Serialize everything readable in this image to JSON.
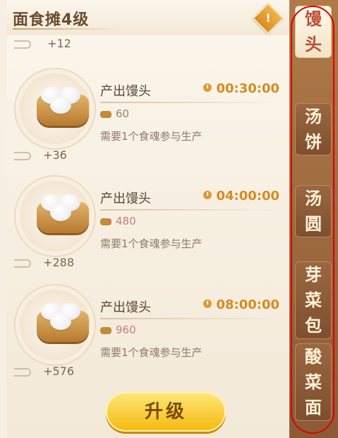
{
  "header": {
    "title": "面食摊4级",
    "info_icon": "!"
  },
  "top_bonus": "+12",
  "items": [
    {
      "title": "产出馒头",
      "time": "00:30:00",
      "amount": "60",
      "requirement": "需要1个食魂参与生产",
      "bonus": "+36",
      "amount_color": "#9a8470"
    },
    {
      "title": "产出馒头",
      "time": "04:00:00",
      "amount": "480",
      "requirement": "需要1个食魂参与生产",
      "bonus": "+288",
      "amount_color": "#c87d86"
    },
    {
      "title": "产出馒头",
      "time": "08:00:00",
      "amount": "960",
      "requirement": "需要1个食魂参与生产",
      "bonus": "+576",
      "amount_color": "#c87d86"
    }
  ],
  "upgrade_button": "升级",
  "side_tabs": [
    {
      "label": [
        "馒",
        "头"
      ],
      "active": true
    },
    {
      "label": [
        "汤",
        "饼"
      ],
      "active": false
    },
    {
      "label": [
        "汤",
        "圆"
      ],
      "active": false
    },
    {
      "label": [
        "芽",
        "菜",
        "包"
      ],
      "active": false
    },
    {
      "label": [
        "酸",
        "菜",
        "面"
      ],
      "active": false
    }
  ]
}
